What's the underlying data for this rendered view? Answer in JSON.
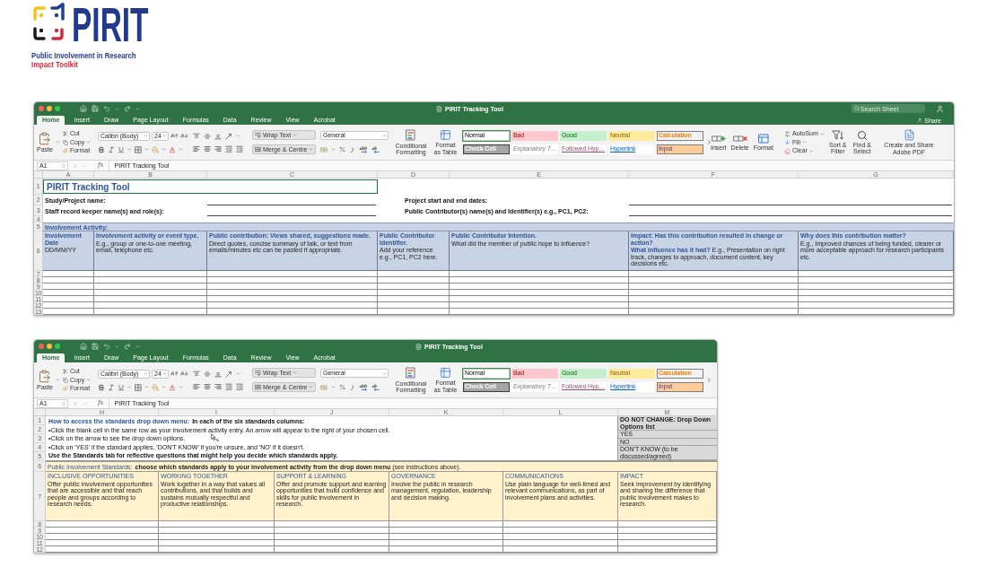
{
  "logo": {
    "wordmark": "PIRIT",
    "tagline": "Public Involvement in Research",
    "subtitle": "Impact Toolkit"
  },
  "windows": [
    {
      "title": "PIRIT Tracking Tool",
      "search": {
        "placeholder": "Search Sheet"
      },
      "tabs": [
        {
          "label": "Home",
          "selected": true
        },
        {
          "label": "Insert",
          "selected": false
        },
        {
          "label": "Draw",
          "selected": false
        },
        {
          "label": "Page Layout",
          "selected": false
        },
        {
          "label": "Formulas",
          "selected": false
        },
        {
          "label": "Data",
          "selected": false
        },
        {
          "label": "Review",
          "selected": false
        },
        {
          "label": "View",
          "selected": false
        },
        {
          "label": "Acrobat",
          "selected": false
        }
      ],
      "share": "Share",
      "ribbon": {
        "clipboard": {
          "paste": "Paste",
          "cut": "Cut",
          "copy": "Copy",
          "format": "Format"
        },
        "font": {
          "name": "Calibri (Body)",
          "size": "24"
        },
        "alignment": {
          "wrap": "Wrap Text",
          "merge": "Merge & Centre"
        },
        "number": {
          "format": "General"
        },
        "styles": {
          "conditional": "Conditional Formatting",
          "table": "Format as Table",
          "cell_styles": [
            {
              "label": "Normal",
              "kind": "normal",
              "selected": true
            },
            {
              "label": "Bad",
              "kind": "bad",
              "selected": false
            },
            {
              "label": "Good",
              "kind": "good",
              "selected": false
            },
            {
              "label": "Neutral",
              "kind": "neutral",
              "selected": false
            },
            {
              "label": "Calculation",
              "kind": "calculation",
              "selected": false
            },
            {
              "label": "Check Cell",
              "kind": "check",
              "selected": false
            },
            {
              "label": "Explanatory T…",
              "kind": "explanatory",
              "selected": false
            },
            {
              "label": "Followed Hyp…",
              "kind": "followed",
              "selected": false
            },
            {
              "label": "Hyperlink",
              "kind": "hyperlink",
              "selected": false
            },
            {
              "label": "Input",
              "kind": "input",
              "selected": false
            }
          ]
        },
        "cells": {
          "insert": "Insert",
          "delete": "Delete",
          "format": "Format"
        },
        "editing": {
          "autosum": "AutoSum",
          "fill": "Fill",
          "clear": "Clear",
          "sort": "Sort & Filter",
          "find": "Find & Select"
        },
        "adobe": {
          "label": "Create and Share Adobe PDF"
        }
      },
      "formula_bar": {
        "cell": "A1",
        "function_label": "fx",
        "value": "PIRIT Tracking Tool"
      },
      "sheet": {
        "kind": "tracking",
        "columns": [
          "A",
          "B",
          "C",
          "D",
          "E",
          "F",
          "G"
        ],
        "row_numbers": [
          "1",
          "2",
          "3",
          "4",
          "5",
          "6",
          "7",
          "8",
          "9",
          "10",
          "11",
          "12",
          "13"
        ],
        "title": "PIRIT Tracking Tool",
        "fields": [
          "Study/Project name:",
          "Project start and end dates:",
          "Staff record keeper name(s) and role(s):",
          "Public Contributor(s) name(s) and Identifier(s) e.g., PC1, PC2:"
        ],
        "section": "Involvement Activity:",
        "headers": [
          {
            "title": "Involvement Date",
            "note": "DD/MM/YY"
          },
          {
            "title": "Involvement activity or event type.",
            "note": "E.g., group or one-to-one meeting, email, telephone etc."
          },
          {
            "title": "Public contribution: Views shared, suggestions made.",
            "note": "Direct quotes, concise summary of talk, or text from emails/minutes etc can be pasted if appropriate."
          },
          {
            "title": "Public Contributor Identifier.",
            "note": "Add your reference e.g., PC1, PC2 here."
          },
          {
            "title": "Public Contributor Intention.",
            "note": "What did the member of public hope to influence?"
          },
          {
            "title": "Impact: Has this contribution resulted in change or action?",
            "note": "**What influence has it had?** E.g., Presentation on right track, changes to approach, document content, key decisions etc."
          },
          {
            "title": "Why does this contribution matter?",
            "note": "E.g., Improved chances of being funded, clearer or more acceptable approach for research participants etc."
          }
        ]
      }
    },
    {
      "title": "PIRIT Tracking Tool",
      "tabs": [
        {
          "label": "Home",
          "selected": true
        },
        {
          "label": "Insert",
          "selected": false
        },
        {
          "label": "Draw",
          "selected": false
        },
        {
          "label": "Page Layout",
          "selected": false
        },
        {
          "label": "Formulas",
          "selected": false
        },
        {
          "label": "Data",
          "selected": false
        },
        {
          "label": "Review",
          "selected": false
        },
        {
          "label": "View",
          "selected": false
        },
        {
          "label": "Acrobat",
          "selected": false
        }
      ],
      "ribbon": {
        "clipboard": {
          "paste": "Paste",
          "cut": "Cut",
          "copy": "Copy",
          "format": "Format"
        },
        "font": {
          "name": "Calibri (Body)",
          "size": "24"
        },
        "alignment": {
          "wrap": "Wrap Text",
          "merge": "Merge & Centre"
        },
        "number": {
          "format": "General"
        },
        "styles": {
          "conditional": "Conditional Formatting",
          "table": "Format as Table",
          "cell_styles": [
            {
              "label": "Normal",
              "kind": "normal",
              "selected": true
            },
            {
              "label": "Bad",
              "kind": "bad",
              "selected": false
            },
            {
              "label": "Good",
              "kind": "good",
              "selected": false
            },
            {
              "label": "Neutral",
              "kind": "neutral",
              "selected": false
            },
            {
              "label": "Calculation",
              "kind": "calculation",
              "selected": false
            },
            {
              "label": "Check Cell",
              "kind": "check",
              "selected": false
            },
            {
              "label": "Explanatory T…",
              "kind": "explanatory",
              "selected": false
            },
            {
              "label": "Followed Hyp…",
              "kind": "followed",
              "selected": false
            },
            {
              "label": "Hyperlink",
              "kind": "hyperlink",
              "selected": false
            },
            {
              "label": "Input",
              "kind": "input",
              "selected": false
            }
          ]
        }
      },
      "formula_bar": {
        "cell": "A1",
        "function_label": "fx",
        "value": "PIRIT Tracking Tool"
      },
      "sheet": {
        "kind": "standards",
        "columns": [
          "H",
          "I",
          "J",
          "K",
          "L",
          "M"
        ],
        "row_numbers": [
          "1",
          "2",
          "3",
          "4",
          "5",
          "6",
          "7",
          "8",
          "9",
          "10",
          "11",
          "12"
        ],
        "instructions": {
          "heading": "How to access the standards drop down menu:",
          "heading_note": "In each of the six standards columns:",
          "steps": [
            "•Click the blank cell in the same row as your involvement activity entry. An arrow will appear to the right of your chosen cell.",
            "•Click on the arrow to see the drop down options.",
            "•Click on 'YES' if the standard applies, 'DON'T KNOW' if you're unsure, and 'NO' if it doesn't."
          ],
          "footer": "Use the Standards tab for reflective questions that might help you decide which standards apply."
        },
        "options": [
          "DO NOT CHANGE: Drop Down Options list",
          "YES",
          "NO",
          "DON'T KNOW (to be discussed/agreed)"
        ],
        "section": {
          "label": "Public Involvement Standards:",
          "text": "**choose which standards apply to your involvement activity from the drop down menu** (see instructions above)."
        },
        "headers": [
          {
            "title": "INCLUSIVE OPPORTUNITIES",
            "note": "Offer public involvement opportunities that are accessible and that reach people and groups according to research needs."
          },
          {
            "title": "WORKING TOGETHER",
            "note": "Work together in a way that values all contributions, and that builds and sustains mutually respectful and productive relationships."
          },
          {
            "title": "SUPPORT & LEARNING",
            "note": "Offer and promote support and learning opportunities that build confidence and skills for public involvement in research."
          },
          {
            "title": "GOVERNANCE",
            "note": "Involve the public in research management, regulation, leadership and decision making."
          },
          {
            "title": "COMMUNICATIONS",
            "note": "Use plain language for well-timed and relevant communications, as part of involvement plans and activities."
          },
          {
            "title": "IMPACT",
            "note": "Seek improvement by identifying and sharing the difference that public involvement makes to research."
          }
        ]
      }
    }
  ]
}
